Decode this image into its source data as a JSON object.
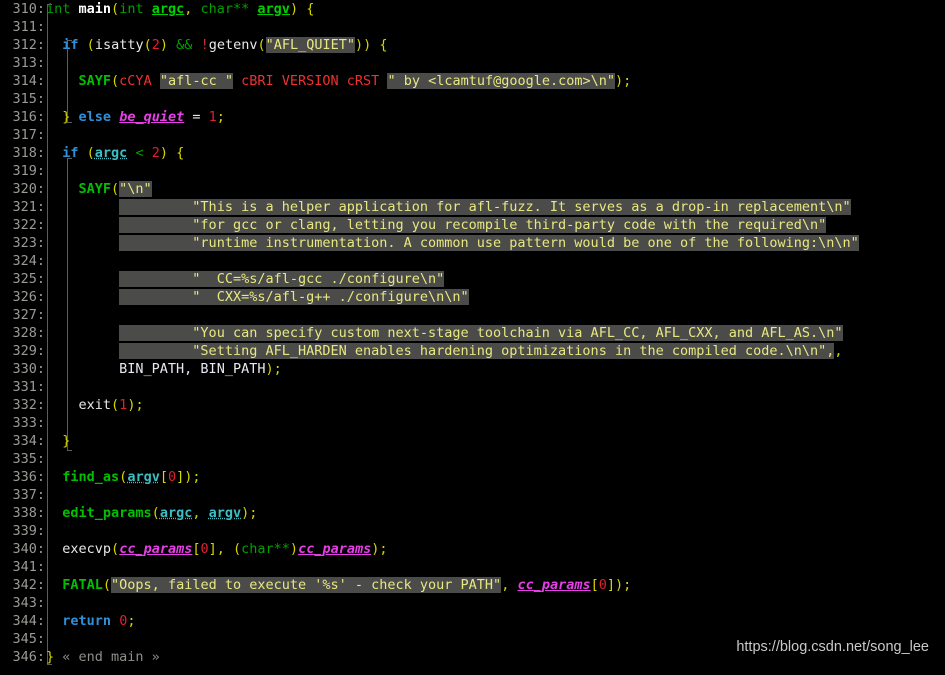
{
  "editor": {
    "language": "C",
    "first_line": 310,
    "last_line": 346,
    "background_color": "#000000",
    "gutter_color": "#9a9a96",
    "string_bg_color": "#4b4b49",
    "string_fg_color": "#e8e882"
  },
  "watermark": {
    "text": "https://blog.csdn.net/song_lee"
  },
  "gutter": {
    "numbers": [
      "310:",
      "311:",
      "312:",
      "313:",
      "314:",
      "315:",
      "316:",
      "317:",
      "318:",
      "319:",
      "320:",
      "321:",
      "322:",
      "323:",
      "324:",
      "325:",
      "326:",
      "327:",
      "328:",
      "329:",
      "330:",
      "331:",
      "332:",
      "333:",
      "334:",
      "335:",
      "336:",
      "337:",
      "338:",
      "339:",
      "340:",
      "341:",
      "342:",
      "343:",
      "344:",
      "345:",
      "346:"
    ]
  },
  "code": {
    "lines": [
      {
        "n": "310",
        "text": "int main(int argc, char** argv) {"
      },
      {
        "n": "311",
        "text": ""
      },
      {
        "n": "312",
        "text": "  if (isatty(2) && !getenv(\"AFL_QUIET\")) {"
      },
      {
        "n": "313",
        "text": ""
      },
      {
        "n": "314",
        "text": "    SAYF(cCYA \"afl-cc \" cBRI VERSION cRST \" by <lcamtuf@google.com>\\n\");"
      },
      {
        "n": "315",
        "text": ""
      },
      {
        "n": "316",
        "text": "  } else be_quiet = 1;"
      },
      {
        "n": "317",
        "text": ""
      },
      {
        "n": "318",
        "text": "  if (argc < 2) {"
      },
      {
        "n": "319",
        "text": ""
      },
      {
        "n": "320",
        "text": "    SAYF(\"\\n\""
      },
      {
        "n": "321",
        "text": "         \"This is a helper application for afl-fuzz. It serves as a drop-in replacement\\n\""
      },
      {
        "n": "322",
        "text": "         \"for gcc or clang, letting you recompile third-party code with the required\\n\""
      },
      {
        "n": "323",
        "text": "         \"runtime instrumentation. A common use pattern would be one of the following:\\n\\n\""
      },
      {
        "n": "324",
        "text": ""
      },
      {
        "n": "325",
        "text": "         \"  CC=%s/afl-gcc ./configure\\n\""
      },
      {
        "n": "326",
        "text": "         \"  CXX=%s/afl-g++ ./configure\\n\\n\""
      },
      {
        "n": "327",
        "text": ""
      },
      {
        "n": "328",
        "text": "         \"You can specify custom next-stage toolchain via AFL_CC, AFL_CXX, and AFL_AS.\\n\""
      },
      {
        "n": "329",
        "text": "         \"Setting AFL_HARDEN enables hardening optimizations in the compiled code.\\n\\n\","
      },
      {
        "n": "330",
        "text": "         BIN_PATH, BIN_PATH);"
      },
      {
        "n": "331",
        "text": ""
      },
      {
        "n": "332",
        "text": "    exit(1);"
      },
      {
        "n": "333",
        "text": ""
      },
      {
        "n": "334",
        "text": "  }"
      },
      {
        "n": "335",
        "text": ""
      },
      {
        "n": "336",
        "text": "  find_as(argv[0]);"
      },
      {
        "n": "337",
        "text": ""
      },
      {
        "n": "338",
        "text": "  edit_params(argc, argv);"
      },
      {
        "n": "339",
        "text": ""
      },
      {
        "n": "340",
        "text": "  execvp(cc_params[0], (char**)cc_params);"
      },
      {
        "n": "341",
        "text": ""
      },
      {
        "n": "342",
        "text": "  FATAL(\"Oops, failed to execute '%s' - check your PATH\", cc_params[0]);"
      },
      {
        "n": "343",
        "text": ""
      },
      {
        "n": "344",
        "text": "  return 0;"
      },
      {
        "n": "345",
        "text": ""
      },
      {
        "n": "346",
        "text": "} « end main »"
      }
    ],
    "tokens": {
      "l310": [
        "int",
        "main",
        "(",
        "int",
        "argc",
        ", ",
        "char**",
        " ",
        "argv",
        ")",
        " {"
      ],
      "l312": [
        "if",
        "(isatty(",
        "2",
        ") ",
        "&&",
        " !",
        "getenv",
        "(",
        "\"AFL_QUIET\"",
        ")) {"
      ],
      "l314": [
        "SAYF",
        "(",
        "cCYA",
        " ",
        "\"afl-cc \"",
        " ",
        "cBRI VERSION cRST",
        " ",
        "\" by <lcamtuf@google.com>\\n\"",
        ");"
      ],
      "l316": [
        "}",
        " else ",
        "be_quiet",
        " = ",
        "1",
        ";"
      ],
      "l318": [
        "if",
        " (",
        "argc",
        " < ",
        "2",
        ") {"
      ],
      "l320": [
        "SAYF",
        "(",
        "\"\\n\""
      ],
      "l330": [
        "BIN_PATH, BIN_PATH",
        ");"
      ],
      "l332": [
        "exit",
        "(",
        "1",
        ");"
      ],
      "l336": [
        "find_as",
        "(",
        "argv",
        "[",
        "0",
        "]);"
      ],
      "l338": [
        "edit_params",
        "(",
        "argc",
        ", ",
        "argv",
        ");"
      ],
      "l340": [
        "execvp",
        "(",
        "cc_params",
        "[",
        "0",
        "], (",
        "char**",
        ")",
        "cc_params",
        ");"
      ],
      "l342": [
        "FATAL",
        "(",
        "\"Oops, failed to execute '%s' - check your PATH\"",
        ", ",
        "cc_params",
        "[",
        "0",
        "]);"
      ],
      "l344": [
        "return",
        " ",
        "0",
        ";"
      ],
      "l346": [
        "}",
        " « end main »"
      ]
    }
  }
}
